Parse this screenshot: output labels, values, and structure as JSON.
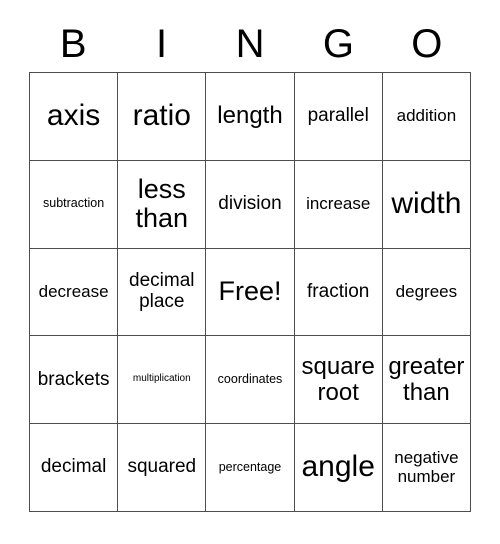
{
  "card": {
    "title": "BINGO",
    "header_letters": [
      "B",
      "I",
      "N",
      "G",
      "O"
    ],
    "free_space_label": "Free!",
    "colors": {
      "border": "#4d4d4d",
      "background": "#ffffff",
      "text": "#000000"
    },
    "rows": [
      [
        {
          "text": "axis",
          "size": "fs-3xl"
        },
        {
          "text": "ratio",
          "size": "fs-3xl"
        },
        {
          "text": "length",
          "size": "fs-xl"
        },
        {
          "text": "parallel",
          "size": "fs-lg"
        },
        {
          "text": "addition",
          "size": "fs-md"
        }
      ],
      [
        {
          "text": "subtraction",
          "size": "fs-sm"
        },
        {
          "text": "less\nthan",
          "size": "fs-2xl"
        },
        {
          "text": "division",
          "size": "fs-lg"
        },
        {
          "text": "increase",
          "size": "fs-md"
        },
        {
          "text": "width",
          "size": "fs-3xl"
        }
      ],
      [
        {
          "text": "decrease",
          "size": "fs-md"
        },
        {
          "text": "decimal\nplace",
          "size": "fs-lg"
        },
        {
          "text": "Free!",
          "size": "fs-2xl"
        },
        {
          "text": "fraction",
          "size": "fs-lg"
        },
        {
          "text": "degrees",
          "size": "fs-md"
        }
      ],
      [
        {
          "text": "brackets",
          "size": "fs-lg"
        },
        {
          "text": "multiplication",
          "size": "fs-xs"
        },
        {
          "text": "coordinates",
          "size": "fs-sm"
        },
        {
          "text": "square\nroot",
          "size": "fs-xl"
        },
        {
          "text": "greater\nthan",
          "size": "fs-xl"
        }
      ],
      [
        {
          "text": "decimal",
          "size": "fs-lg"
        },
        {
          "text": "squared",
          "size": "fs-lg"
        },
        {
          "text": "percentage",
          "size": "fs-sm"
        },
        {
          "text": "angle",
          "size": "fs-3xl"
        },
        {
          "text": "negative\nnumber",
          "size": "fs-md"
        }
      ]
    ]
  }
}
